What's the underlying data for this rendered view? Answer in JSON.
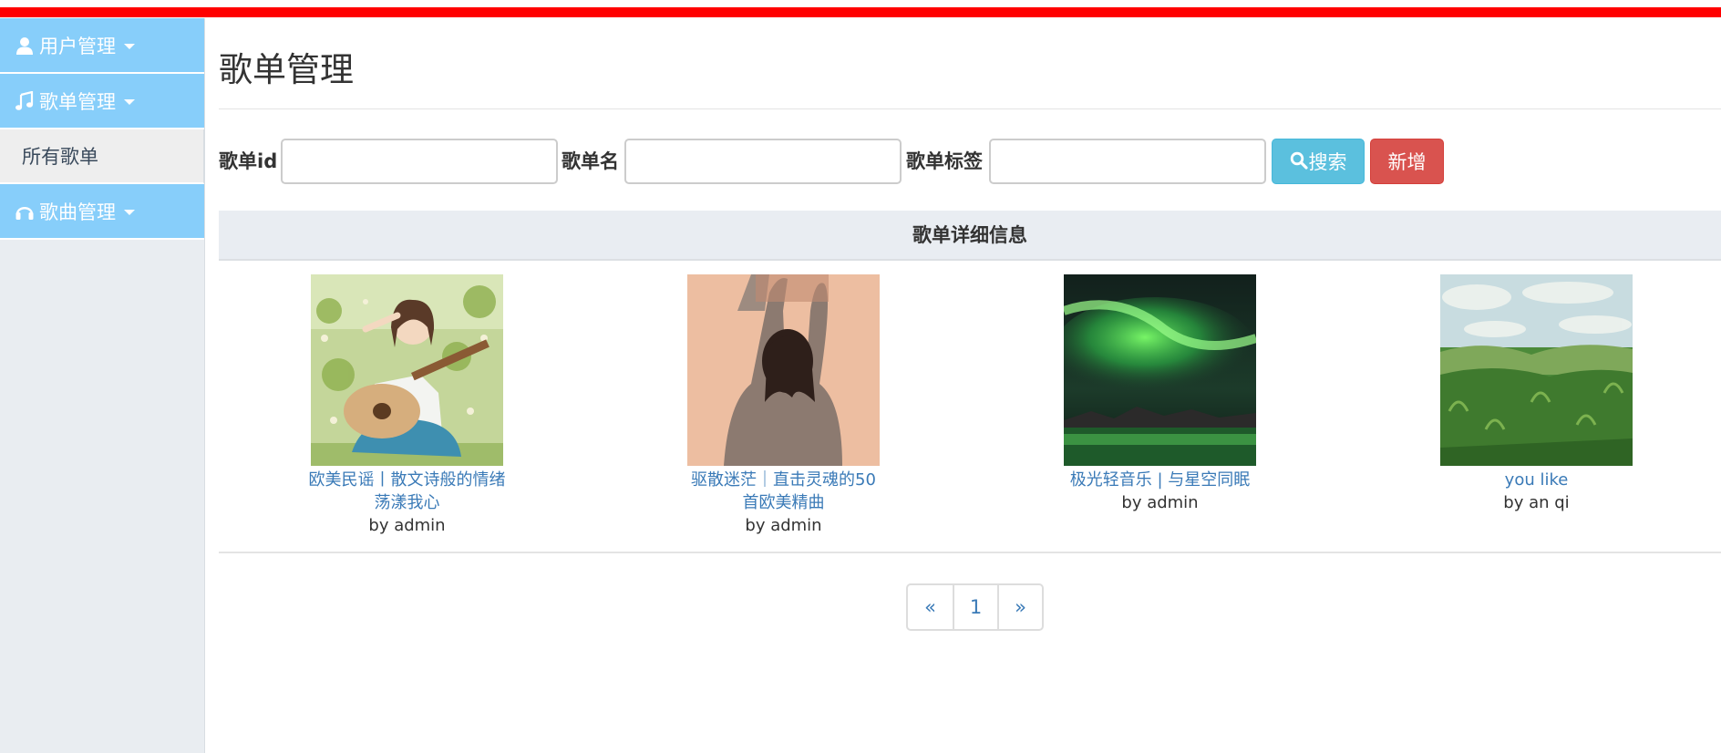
{
  "sidebar": {
    "menus": [
      {
        "label": "用户管理",
        "icon": "user-icon"
      },
      {
        "label": "歌单管理",
        "icon": "music-note-icon"
      },
      {
        "label": "歌曲管理",
        "icon": "headphones-icon"
      }
    ],
    "submenu": {
      "label": "所有歌单"
    }
  },
  "page": {
    "title": "歌单管理"
  },
  "search": {
    "id_label": "歌单id",
    "id_value": "",
    "name_label": "歌单名",
    "name_value": "",
    "tag_label": "歌单标签",
    "tag_value": "",
    "search_button": "搜索",
    "add_button": "新增"
  },
  "detail": {
    "header": "歌单详细信息",
    "playlists": [
      {
        "title": "欧美民谣丨散文诗般的情绪荡漾我心",
        "author": "by admin",
        "cover": "girl-with-guitar-illustration"
      },
      {
        "title": "驱散迷茫｜直击灵魂的50首欧美精曲",
        "author": "by admin",
        "cover": "girl-arms-raised-photo"
      },
      {
        "title": "极光轻音乐 | 与星空同眠",
        "author": "by admin",
        "cover": "aurora-night-sky-photo"
      },
      {
        "title": "you like",
        "author": "by an qi",
        "cover": "painted-wheat-field"
      }
    ]
  },
  "pagination": {
    "prev": "«",
    "current": "1",
    "next": "»"
  },
  "colors": {
    "top_bar": "#ff0000",
    "menu_bg": "#87cefa",
    "sidebar_bg": "#e9edf1",
    "btn_search": "#5bc0de",
    "btn_add": "#d9534f",
    "link": "#3a7ab7"
  }
}
